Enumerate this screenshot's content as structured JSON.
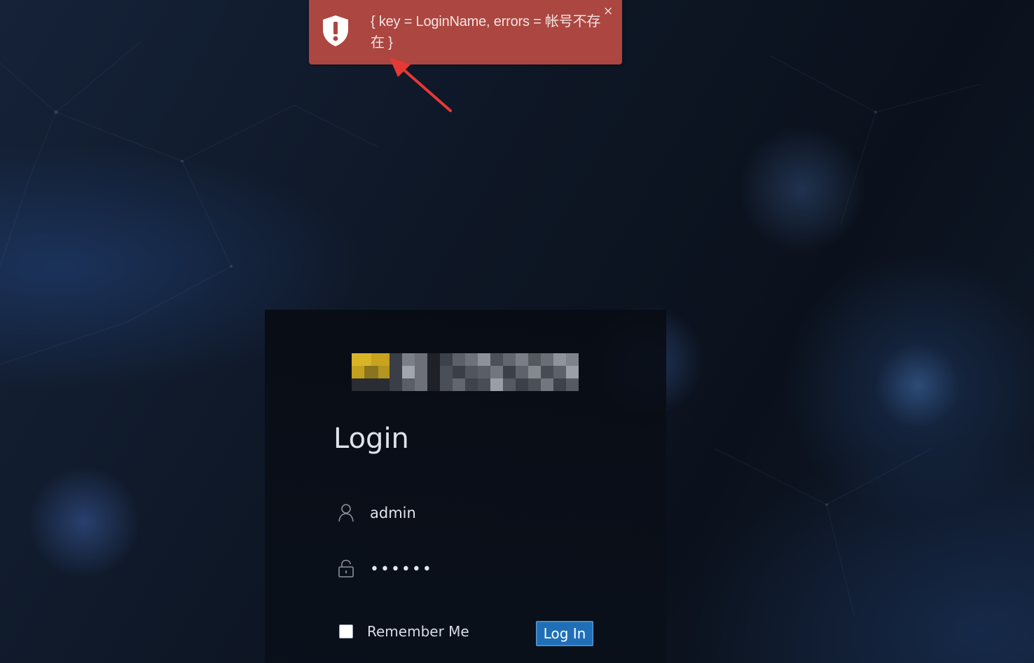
{
  "notification": {
    "type": "error",
    "message": "{ key = LoginName, errors = 帐号不存在 }",
    "close_label": "×",
    "icon": "shield-alert-icon",
    "background_color": "#ab4641"
  },
  "login": {
    "logo_alt": "company-logo (pixelated)",
    "title": "Login",
    "username": {
      "value": "admin",
      "icon": "user-icon"
    },
    "password": {
      "value": "••••••",
      "icon": "lock-icon"
    },
    "remember_me": {
      "label": "Remember Me",
      "checked": false
    },
    "submit_label": "Log In",
    "accent_color": "#1f6fb8"
  }
}
